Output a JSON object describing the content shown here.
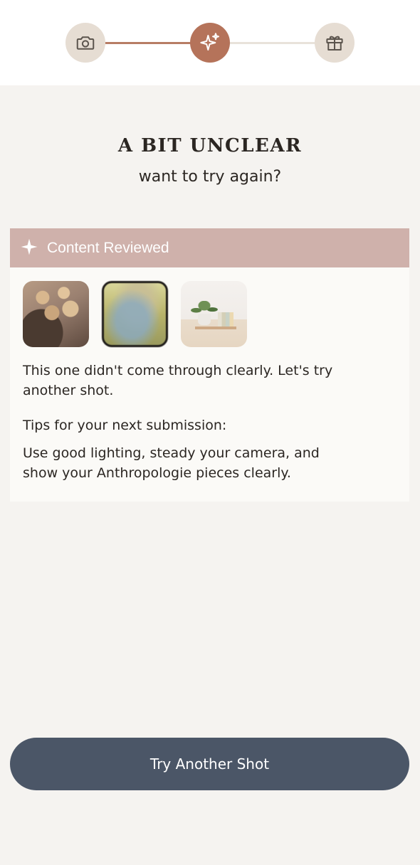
{
  "stepper": {
    "steps": [
      {
        "icon": "camera-icon",
        "state": "complete"
      },
      {
        "icon": "sparkle-icon",
        "state": "active"
      },
      {
        "icon": "gift-icon",
        "state": "pending"
      }
    ],
    "colors": {
      "active": "#b5735a",
      "inactive": "#e6ddd3",
      "line_done": "#b77d65",
      "line_pending": "#e8e2da"
    }
  },
  "heading": {
    "title": "A BIT UNCLEAR",
    "subtitle": "want to try again?"
  },
  "review_card": {
    "header_icon": "sparkle-icon",
    "header_label": "Content Reviewed",
    "header_color": "#cfb1ab",
    "thumbnails": [
      {
        "name": "photo-thumbnail-ceramics",
        "selected": false
      },
      {
        "name": "photo-thumbnail-blurry",
        "selected": true
      },
      {
        "name": "photo-thumbnail-shelf-plant",
        "selected": false
      }
    ],
    "message": "This one didn't come through clearly. Let's try another shot.",
    "tips_heading": "Tips for your next submission:",
    "tips_text": "Use good lighting, steady your camera, and show your Anthropologie pieces clearly."
  },
  "actions": {
    "primary_label": "Try Another Shot",
    "primary_color": "#4b5667"
  }
}
